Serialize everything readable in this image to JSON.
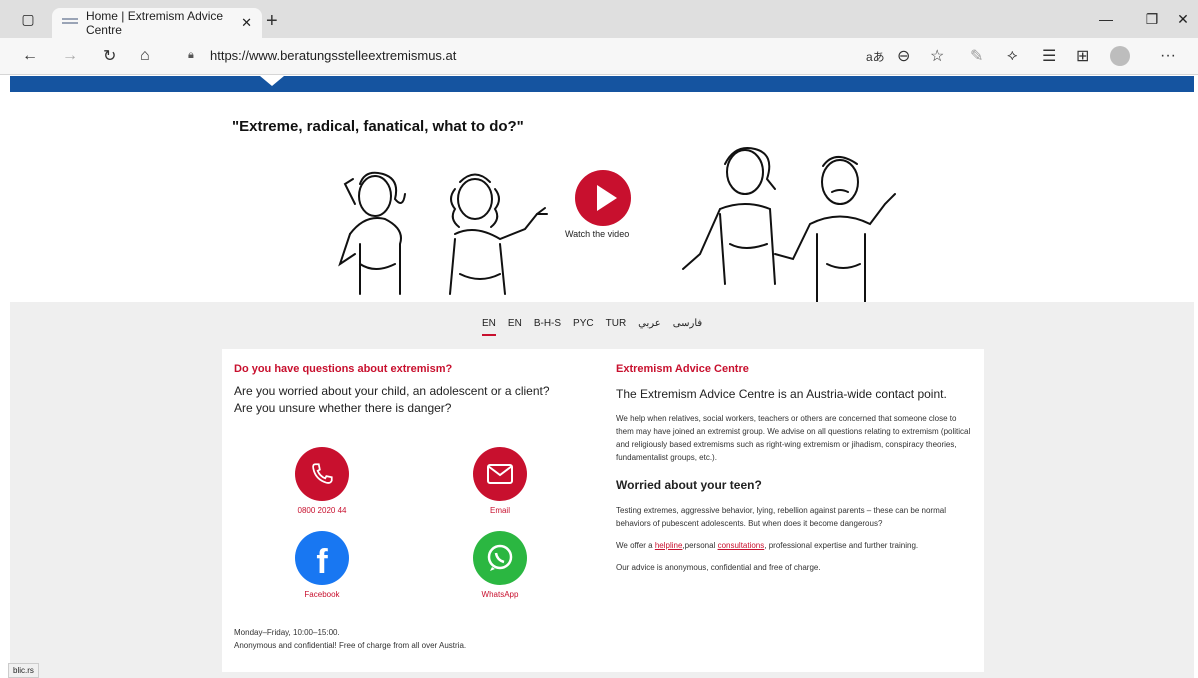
{
  "browser": {
    "tab_title": "Home | Extremism Advice Centre",
    "url": "https://www.beratungsstelleextremismus.at",
    "status_url": "blic.rs",
    "translate_label": "aあ"
  },
  "page": {
    "headline": "\"Extreme, radical, fanatical, what to do?\"",
    "watch_video": "Watch the video",
    "languages": [
      "EN",
      "EN",
      "B-H-S",
      "PYC",
      "TUR",
      "عربي",
      "فارسی"
    ],
    "left": {
      "title": "Do you have questions about extremism?",
      "lead1": "Are you worried about your child, an adolescent or a client?",
      "lead2": "Are you unsure whether there is danger?",
      "phone": "0800 2020 44",
      "email": "Email",
      "facebook": "Facebook",
      "whatsapp": "WhatsApp",
      "hours": "Monday–Friday, 10:00–15:00.",
      "note": "Anonymous and confidential! Free of charge from all over Austria."
    },
    "right": {
      "title": "Extremism Advice Centre",
      "lead": "The Extremism Advice Centre is an Austria-wide contact point.",
      "body": "We help when relatives, social workers, teachers or others are concerned that someone close to them may have joined an extremist group. We advise on all questions relating to extremism (political and religiously based extremisms such as right-wing extremism or jihadism, conspiracy theories, fundamentalist groups, etc.).",
      "teen_title": "Worried about your teen?",
      "teen_body": "Testing extremes, aggressive behavior, lying, rebellion against parents – these can be normal behaviors of pubescent adolescents. But when does it become dangerous?",
      "offer_prefix": "We offer a ",
      "helpline": "helpline",
      "offer_mid": ",personal ",
      "consultations": "consultations",
      "offer_suffix": ", professional expertise and further training.",
      "closing": "Our advice is anonymous, confidential and free of charge."
    }
  }
}
